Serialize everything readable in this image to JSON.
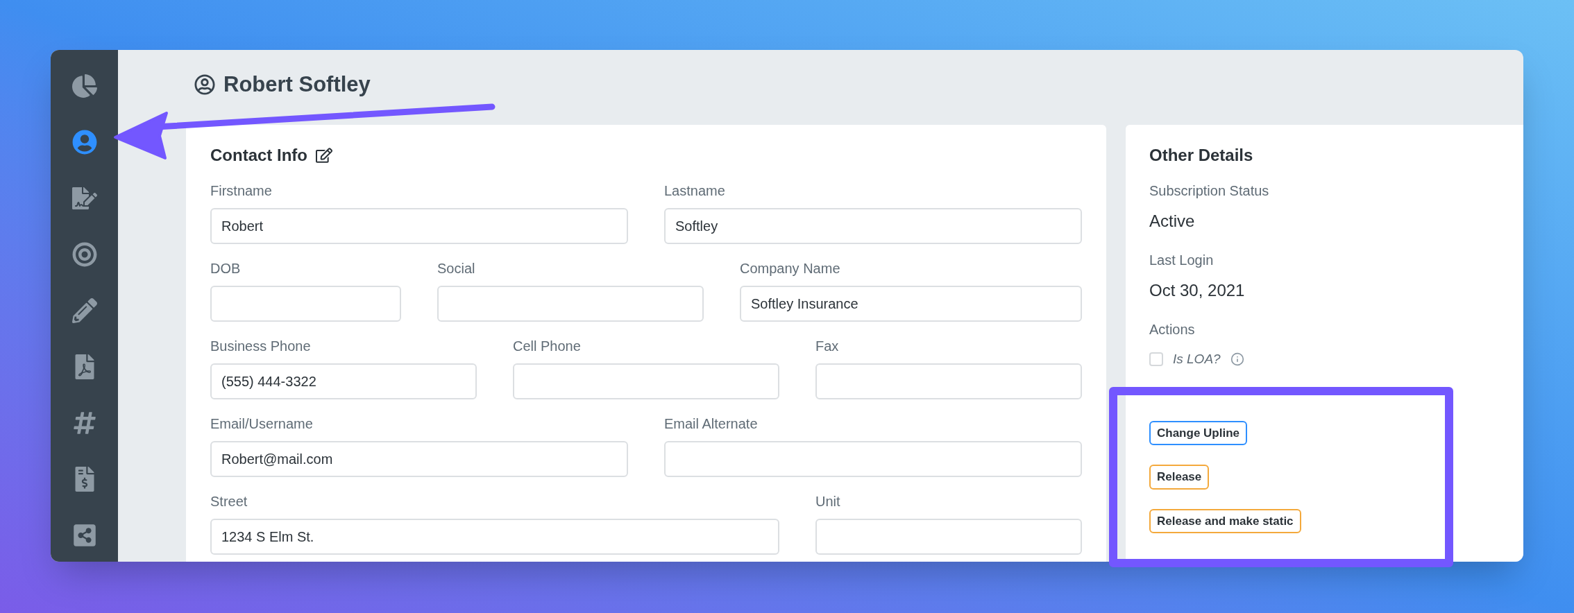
{
  "sidebar": {
    "items": [
      {
        "selected": false
      },
      {
        "selected": true
      },
      {
        "selected": false
      },
      {
        "selected": false
      },
      {
        "selected": false
      },
      {
        "selected": false
      },
      {
        "selected": false
      },
      {
        "selected": false
      },
      {
        "selected": false
      }
    ]
  },
  "header": {
    "title": "Robert Softley"
  },
  "contact": {
    "title": "Contact Info",
    "fields": [
      {
        "label": "Firstname",
        "value": "Robert"
      },
      {
        "label": "Lastname",
        "value": "Softley"
      },
      {
        "label": "DOB"
      },
      {
        "label": "Social"
      },
      {
        "label": "Company Name",
        "value": "Softley Insurance"
      },
      {
        "label": "Business Phone",
        "value": "(555) 444-3322"
      },
      {
        "label": "Cell Phone"
      },
      {
        "label": "Fax"
      },
      {
        "label": "Email/Username",
        "value": "Robert@mail.com"
      },
      {
        "label": "Email Alternate"
      },
      {
        "label": "Street",
        "value": "1234 S Elm St."
      },
      {
        "label": "Unit"
      }
    ]
  },
  "other_details": {
    "title": "Other Details",
    "items": [
      {
        "label": "Subscription Status",
        "value": "Active"
      },
      {
        "label": "Last Login",
        "value": "Oct 30, 2021"
      }
    ],
    "actions_label": "Actions",
    "loa": {
      "label": "Is LOA?",
      "checked": false
    },
    "buttons": [
      {
        "label": "Change Upline",
        "color": "#2e8fff"
      },
      {
        "label": "Release",
        "color": "#f4a93c"
      },
      {
        "label": "Release and make static",
        "color": "#f4a93c"
      }
    ]
  }
}
